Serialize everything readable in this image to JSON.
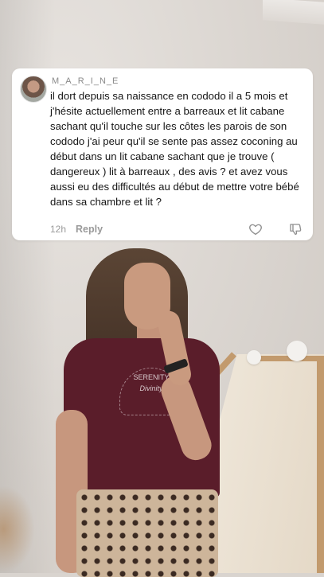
{
  "comment": {
    "username": "M_A_R_I_N_E",
    "text": "il dort depuis sa naissance en cododo il a 5 mois et j'hésite actuellement entre a barreaux et lit cabane sachant qu'il touche sur les côtes les parois de son cododo j'ai peur qu'il se sente pas assez coconing au début dans un lit cabane sachant que je trouve ( dangereux ) lit à barreaux , des avis ? et avez vous aussi eu des difficultés au début de mettre votre bébé dans sa chambre et lit ?",
    "time": "12h",
    "reply_label": "Reply",
    "like_icon": "heart-outline-icon",
    "dislike_icon": "thumbs-down-icon"
  },
  "photo": {
    "shirt_print_line1": "SERENITY",
    "shirt_print_line2": "Divinity"
  },
  "colors": {
    "card_bg": "#ffffff",
    "shirt": "#5a1d2a",
    "meta_gray": "#9a9a9a"
  }
}
